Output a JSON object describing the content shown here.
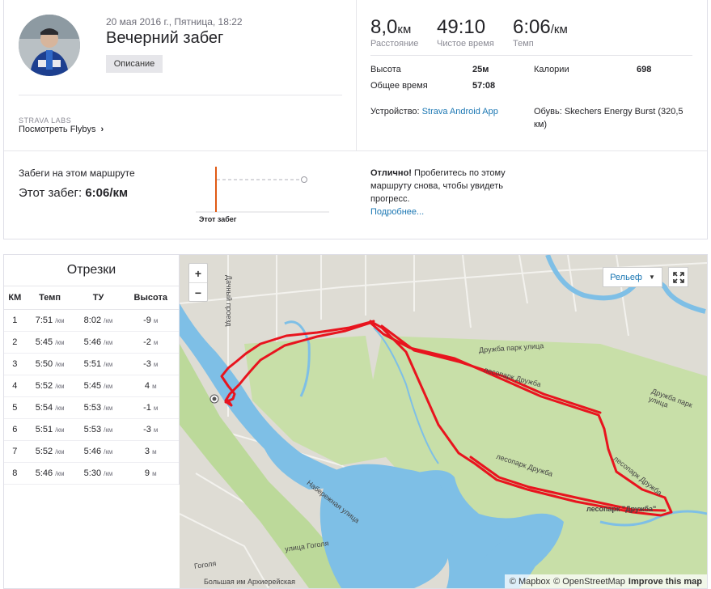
{
  "activity": {
    "date": "20 мая 2016 г., Пятница, 18:22",
    "title": "Вечерний забег",
    "description_button": "Описание",
    "labs_label": "STRAVA LABS",
    "flyby_link": "Посмотреть Flybys"
  },
  "stats": {
    "distance_value": "8,0",
    "distance_unit": "км",
    "distance_label": "Расстояние",
    "moving_time_value": "49:10",
    "moving_time_label": "Чистое время",
    "pace_value": "6:06",
    "pace_unit": "/км",
    "pace_label": "Темп",
    "elevation_label": "Высота",
    "elevation_value": "25м",
    "calories_label": "Калории",
    "calories_value": "698",
    "elapsed_label": "Общее время",
    "elapsed_value": "57:08",
    "device_label": "Устройство:",
    "device_value": "Strava Android App",
    "shoes_label": "Обувь:",
    "shoes_value": "Skechers Energy Burst (320,5 км)"
  },
  "route_compare": {
    "title": "Забеги на этом маршруте",
    "this_run_prefix": "Этот забег:",
    "this_run_value": "6:06/км",
    "chart_label": "Этот забег",
    "advice_bold": "Отлично!",
    "advice_text": "Пробегитесь по этому маршруту снова, чтобы увидеть прогресс.",
    "advice_link": "Подробнее..."
  },
  "splits": {
    "title": "Отрезки",
    "columns": [
      "КМ",
      "Темп",
      "ТУ",
      "Высота"
    ],
    "pace_unit": "/км",
    "elev_unit": "м",
    "rows": [
      {
        "km": "1",
        "pace": "7:51",
        "gap": "8:02",
        "elev": "-9"
      },
      {
        "km": "2",
        "pace": "5:45",
        "gap": "5:46",
        "elev": "-2"
      },
      {
        "km": "3",
        "pace": "5:50",
        "gap": "5:51",
        "elev": "-3"
      },
      {
        "km": "4",
        "pace": "5:52",
        "gap": "5:45",
        "elev": "4"
      },
      {
        "km": "5",
        "pace": "5:54",
        "gap": "5:53",
        "elev": "-1"
      },
      {
        "km": "6",
        "pace": "5:51",
        "gap": "5:53",
        "elev": "-3"
      },
      {
        "km": "7",
        "pace": "5:52",
        "gap": "5:46",
        "elev": "3"
      },
      {
        "km": "8",
        "pace": "5:46",
        "gap": "5:30",
        "elev": "9"
      }
    ]
  },
  "map": {
    "zoom_in": "+",
    "zoom_out": "−",
    "layer_select": "Рельеф",
    "attribution_mapbox": "© Mapbox",
    "attribution_osm": "© OpenStreetMap",
    "attribution_improve": "Improve this map",
    "labels": {
      "street1": "Дружба парк улица",
      "street2": "Дружба парк улица",
      "park1": "лесопарк Дружба",
      "park2": "лесопарк Дружба",
      "park3": "лесопарк Дружба",
      "park4": "лесопарк \"Дружба\"",
      "embankment": "Набережная улица",
      "gogol1": "улица Гоголя",
      "gogol2": "Гоголя",
      "passage": "Дачный проезд",
      "bottom": "Большая им Архиерейская"
    },
    "colors": {
      "route": "#e8141e",
      "water": "#7ebfe6",
      "park": "#c8dfa8",
      "land": "#dedcd4"
    }
  }
}
